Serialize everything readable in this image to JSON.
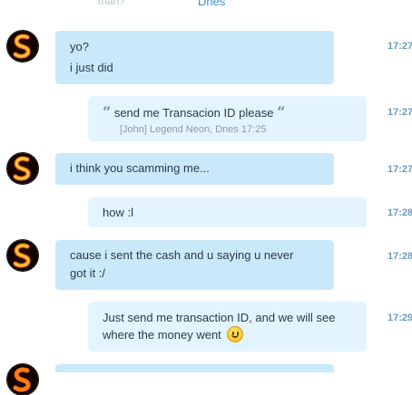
{
  "header": {
    "faded_left": "man?",
    "date_label": "Dnes"
  },
  "messages": [
    {
      "lines": [
        "yo?",
        "i just did"
      ],
      "time": "17:27"
    },
    {
      "quote_text": "send me Transacion ID please",
      "quote_meta": "[John] Legend Neon, Dnes 17:25",
      "time": "17:27"
    },
    {
      "lines": [
        "i think you scamming me..."
      ],
      "time": "17:27"
    },
    {
      "lines": [
        "how :l"
      ],
      "time": "17:28"
    },
    {
      "lines": [
        "cause i sent the cash and u saying u never",
        "got it :/"
      ],
      "time": "17:28"
    },
    {
      "lines": [
        "Just send me transaction ID, and we will see",
        "where the money went"
      ],
      "time": "17:29",
      "emoji": "smiley"
    }
  ],
  "icons": {
    "avatar": "flame-s-avatar",
    "quote_open": "quote-open-icon",
    "quote_close": "quote-close-icon",
    "emoji": "smiley-emoji"
  },
  "colors": {
    "incoming_bubble": "#c9e9fb",
    "outgoing_bubble": "#e4f4fd",
    "timestamp": "#6a9bbe",
    "date_link": "#3a8fd0"
  }
}
